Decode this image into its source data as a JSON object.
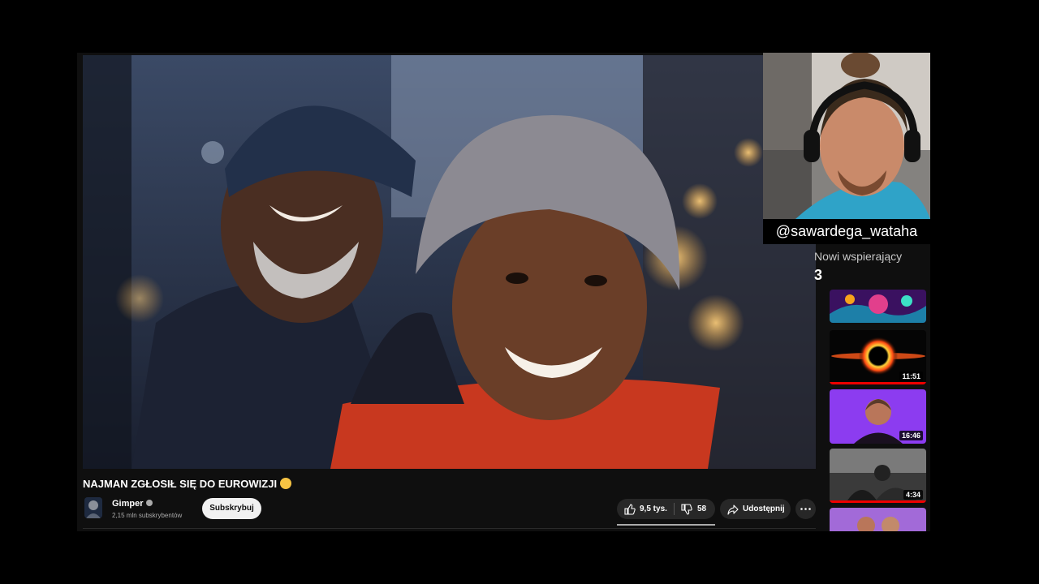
{
  "streamer": {
    "handle": "@sawardega_wataha"
  },
  "supporters": {
    "title": "Nowi wspierający",
    "count": "3"
  },
  "video": {
    "title": "NAJMAN ZGŁOSIŁ SIĘ DO EUROWIZJI",
    "channel": "Gimper",
    "subscribers": "2,15 mln subskrybentów",
    "subscribe_label": "Subskrybuj",
    "likes": "9,5 tys.",
    "dislikes": "58",
    "share_label": "Udostępnij"
  },
  "suggestions": [
    {
      "duration": ""
    },
    {
      "duration": "11:51"
    },
    {
      "duration": "16:46"
    },
    {
      "duration": "4:34"
    },
    {
      "duration": ""
    }
  ],
  "colors": {
    "accent": "#ff0000",
    "background": "#0f0f0f",
    "button": "#272727"
  }
}
